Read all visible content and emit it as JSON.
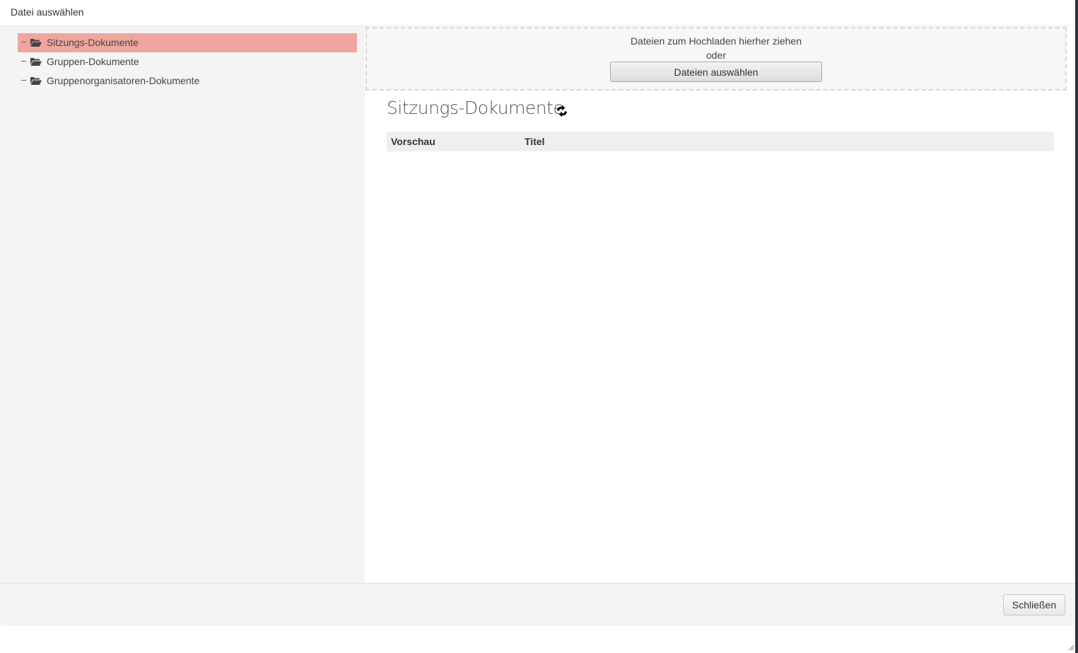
{
  "dialog": {
    "title": "Datei auswählen"
  },
  "tree": {
    "items": [
      {
        "label": "Sitzungs-Dokumente",
        "toggle": "–",
        "selected": true
      },
      {
        "label": "Gruppen-Dokumente",
        "toggle": "–",
        "selected": false
      },
      {
        "label": "Gruppenorganisatoren-Dokumente",
        "toggle": "–",
        "selected": false
      }
    ],
    "folder_icon": "folder-open-icon"
  },
  "upload": {
    "drop_text": "Dateien zum Hochladen hierher ziehen",
    "or_text": "oder",
    "button_label": "Dateien auswählen"
  },
  "content": {
    "folder_title": "Sitzungs-Dokumente",
    "refresh_icon": "refresh-icon",
    "columns": [
      "Vorschau",
      "Titel"
    ]
  },
  "footer": {
    "close_label": "Schließen"
  },
  "colors": {
    "selected_bg": "#efa6a0",
    "pane_bg": "#f4f4f4",
    "header_bg": "#efefef"
  }
}
